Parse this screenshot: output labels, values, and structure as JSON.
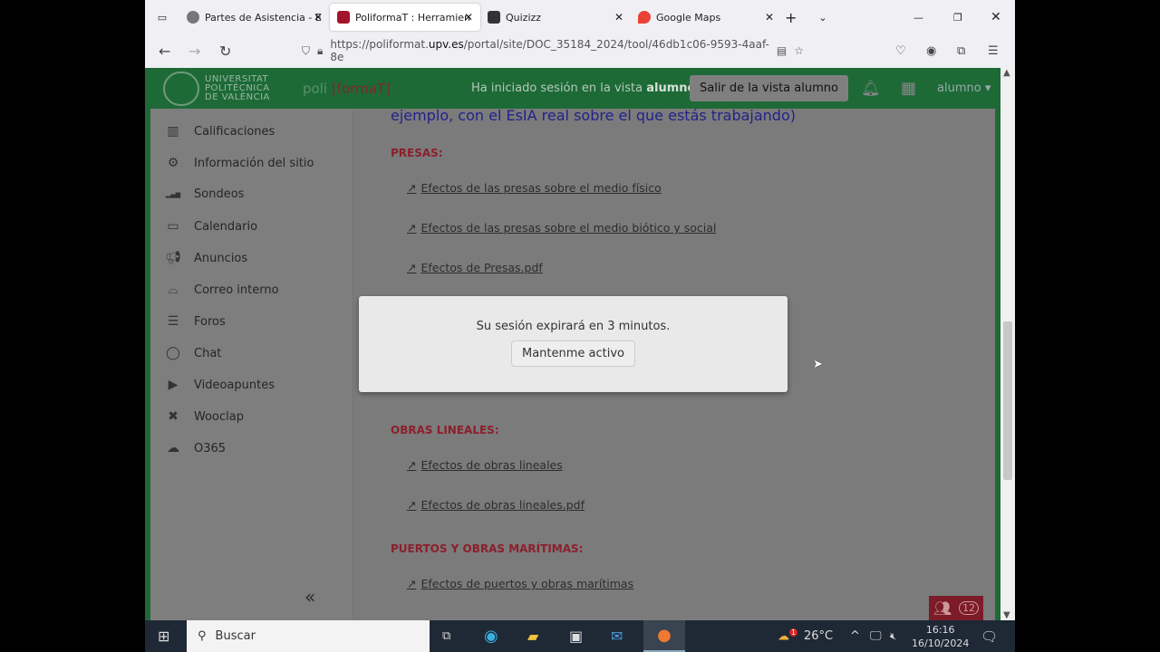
{
  "browser": {
    "tabs": [
      {
        "label": "Partes de Asistencia - E",
        "active": false
      },
      {
        "label": "PoliformaT : Herramien",
        "active": true
      },
      {
        "label": "Quizizz",
        "active": false
      },
      {
        "label": "Google Maps",
        "active": false
      }
    ],
    "url_prefix": "https://poliformat.",
    "url_domain": "upv.es",
    "url_rest": "/portal/site/DOC_35184_2024/tool/46db1c06-9593-4aaf-8e"
  },
  "header": {
    "university": [
      "UNIVERSITAT",
      "POLITÈCNICA",
      "DE VALÈNCIA"
    ],
    "logo_poli": "poli",
    "logo_format": "[formaT]",
    "session_text": "Ha iniciado sesión en la vista ",
    "session_role": "alumno",
    "exit_button": "Salir de la vista alumno",
    "user": "alumno"
  },
  "sidebar": {
    "items": [
      {
        "label": "Calificaciones",
        "icon": "grades-icon"
      },
      {
        "label": "Información del sitio",
        "icon": "gear-icon"
      },
      {
        "label": "Sondeos",
        "icon": "poll-icon"
      },
      {
        "label": "Calendario",
        "icon": "calendar-icon"
      },
      {
        "label": "Anuncios",
        "icon": "megaphone-icon"
      },
      {
        "label": "Correo interno",
        "icon": "inbox-icon"
      },
      {
        "label": "Foros",
        "icon": "forum-icon"
      },
      {
        "label": "Chat",
        "icon": "chat-icon"
      },
      {
        "label": "Videoapuntes",
        "icon": "video-icon"
      },
      {
        "label": "Wooclap",
        "icon": "wooclap-icon"
      },
      {
        "label": "O365",
        "icon": "cloud-icon"
      }
    ],
    "collapse": "«"
  },
  "content": {
    "intro": "ejemplo, con el EsIA real sobre el que estás trabajando)",
    "sections": [
      {
        "title": "PRESAS:",
        "links": [
          "Efectos de las presas sobre el medio físico",
          "Efectos de las presas sobre el medio biótico y social",
          "Efectos de Presas.pdf"
        ]
      },
      {
        "title": "OBRAS LINEALES:",
        "links": [
          "Efectos de obras lineales",
          "Efectos de obras lineales.pdf"
        ]
      },
      {
        "title": "PUERTOS Y OBRAS MARÍTIMAS:",
        "links": [
          "Efectos de puertos y obras marítimas"
        ]
      }
    ]
  },
  "modal": {
    "message": "Su sesión expirará en 3 minutos.",
    "button": "Mantenme activo"
  },
  "presence": {
    "count": "12"
  },
  "taskbar": {
    "search": "Buscar",
    "weather": "26°C",
    "weather_badge": "1",
    "time": "16:16",
    "date": "16/10/2024"
  },
  "colors": {
    "header_green": "#1d6a37",
    "section_red": "#8c1f2c"
  }
}
